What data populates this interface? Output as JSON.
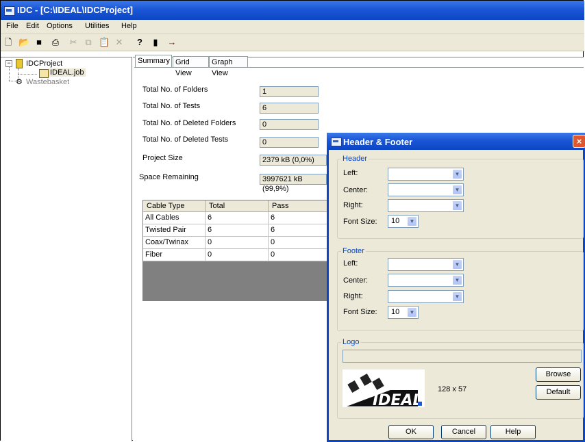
{
  "window": {
    "title": "IDC - [C:\\IDEAL\\IDCProject]"
  },
  "menu": [
    "File",
    "Edit",
    "Options",
    "Utilities",
    "Help"
  ],
  "toolbar": {
    "icons": [
      "new-icon",
      "open-icon",
      "save-icon",
      "print-icon",
      "cut-icon",
      "copy-icon",
      "paste-icon",
      "delete-icon",
      "help-icon",
      "project-icon",
      "export-icon"
    ],
    "help_glyph": "?"
  },
  "tree": {
    "root": "IDCProject",
    "job": "IDEAL.job",
    "wastebasket": "Wastebasket"
  },
  "tabs": [
    "Summary",
    "Grid View",
    "Graph View"
  ],
  "summary": {
    "rows": [
      {
        "label": "Total No. of Folders",
        "value": "1"
      },
      {
        "label": "Total No. of Tests",
        "value": "6"
      },
      {
        "label": "Total No. of Deleted Folders",
        "value": "0"
      },
      {
        "label": "Total No. of Deleted Tests",
        "value": "0"
      },
      {
        "label": "Project Size",
        "value": "2379 kB  (0,0%)"
      },
      {
        "label": "Space Remaining",
        "value": "3997621 kB  (99,9%)"
      }
    ]
  },
  "cable_table": {
    "headers": [
      "Cable Type",
      "Total",
      "Pass"
    ],
    "rows": [
      [
        "All Cables",
        "6",
        "6"
      ],
      [
        "Twisted Pair",
        "6",
        "6"
      ],
      [
        "Coax/Twinax",
        "0",
        "0"
      ],
      [
        "Fiber",
        "0",
        "0"
      ]
    ]
  },
  "dialog": {
    "title": "Header & Footer",
    "close": "×",
    "header_group": "Header",
    "footer_group": "Footer",
    "logo_group": "Logo",
    "left": "Left:",
    "center": "Center:",
    "right": "Right:",
    "font_size": "Font Size:",
    "header_font_size": "10",
    "footer_font_size": "10",
    "logo_text": "IDEAL",
    "logo_size": "128 x 57",
    "browse": "Browse",
    "default": "Default",
    "ok": "OK",
    "cancel": "Cancel",
    "help": "Help"
  },
  "colors": {
    "titlebar": "#0c46c4",
    "group_label": "#0046d5",
    "close": "#e0562e",
    "face": "#ece9d8"
  }
}
